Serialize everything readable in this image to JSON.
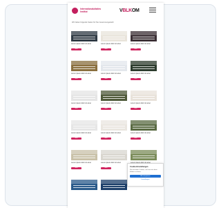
{
  "header": {
    "org_name": "Internationalaltaltes Institut",
    "wordmark_prefix": "V",
    "wordmark_accent": "BLK",
    "wordmark_suffix": "OM"
  },
  "intro": "Wir haben folgende Seiten für Sie zusammengestellt",
  "tiles": [
    {
      "tag": "",
      "caption": "Lorem ipsum dolor sit amet",
      "button": "Mehr",
      "color": "#2f3a44"
    },
    {
      "tag": "",
      "caption": "Lorem ipsum dolor sit amet",
      "button": "Mehr",
      "color": "#e9e4db"
    },
    {
      "tag": "",
      "caption": "Lorem ipsum dolor sit amet",
      "button": "Mehr",
      "color": "#3b2f35"
    },
    {
      "tag": "",
      "caption": "Lorem ipsum dolor sit amet",
      "button": "Mehr",
      "color": "#8a6f3e"
    },
    {
      "tag": "",
      "caption": "Lorem ipsum dolor sit amet",
      "button": "Mehr",
      "color": "#e3e7ec"
    },
    {
      "tag": "",
      "caption": "Lorem ipsum dolor sit amet",
      "button": "Mehr",
      "color": "#2c3b2d"
    },
    {
      "tag": "",
      "caption": "Lorem ipsum dolor sit amet",
      "button": "Mehr",
      "color": "#e5e5e5"
    },
    {
      "tag": "",
      "caption": "Lorem ipsum dolor sit amet",
      "button": "Mehr",
      "color": "#4f5a3a"
    },
    {
      "tag": "",
      "caption": "Lorem ipsum dolor sit amet",
      "button": "Mehr",
      "color": "#e8e2da"
    },
    {
      "tag": "",
      "caption": "Lorem ipsum dolor sit amet",
      "button": "Mehr",
      "color": "#e6e6e6"
    },
    {
      "tag": "",
      "caption": "Lorem ipsum dolor sit amet",
      "button": "Mehr",
      "color": "#eae6e0"
    },
    {
      "tag": "",
      "caption": "Lorem ipsum dolor sit amet",
      "button": "Mehr",
      "color": "#5a6b43"
    },
    {
      "tag": "",
      "caption": "Lorem ipsum dolor sit amet",
      "button": "Mehr",
      "color": "#c9c1a8"
    },
    {
      "tag": "",
      "caption": "Lorem ipsum dolor sit amet",
      "button": "Mehr",
      "color": "#d9d6cf"
    },
    {
      "tag": "",
      "caption": "Lorem ipsum dolor sit amet",
      "button": "Mehr",
      "color": "#7b8c5a"
    },
    {
      "tag": "",
      "caption": "",
      "button": "",
      "color": "#2a5a8a"
    },
    {
      "tag": "",
      "caption": "",
      "button": "",
      "color": "#1d3f6a"
    }
  ],
  "cookie": {
    "title": "Cookie-Einstellungen",
    "text": "Wir verwenden Cookies, um Ihnen das beste Erlebnis zu bieten.",
    "accept": "Alle akzeptieren",
    "settings": "Einstellungen"
  },
  "colors": {
    "accent": "#c31f5e",
    "button": "#d0245f",
    "link": "#1f6fd1"
  }
}
